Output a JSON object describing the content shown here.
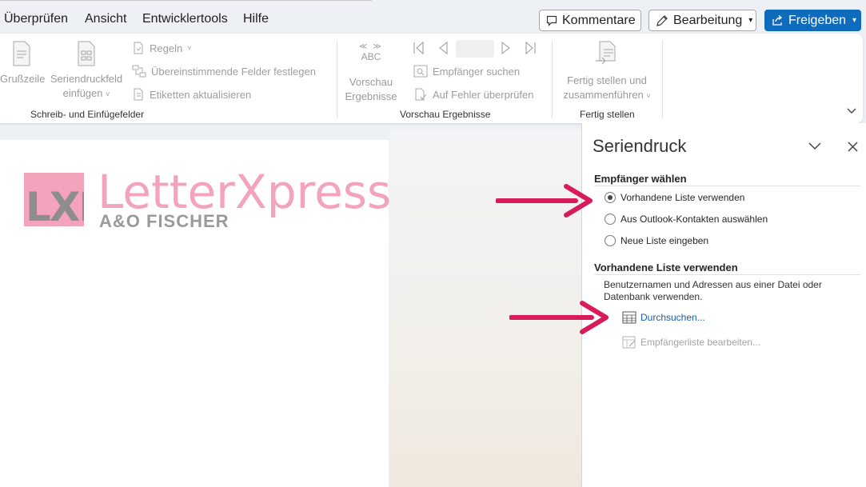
{
  "menu": {
    "items": [
      "Überprüfen",
      "Ansicht",
      "Entwicklertools",
      "Hilfe"
    ],
    "comments_label": "Kommentare",
    "editing_label": "Bearbeitung",
    "share_label": "Freigeben"
  },
  "ribbon": {
    "group1": {
      "greeting_label": "Grußzeile",
      "insert_field_line1": "Seriendruckfeld",
      "insert_field_line2": "einfügen",
      "rules_label": "Regeln",
      "match_fields_label": "Übereinstimmende Felder festlegen",
      "update_labels_label": "Etiketten aktualisieren",
      "group_label": "Schreib- und Einfügefelder"
    },
    "group2": {
      "abc_label": "ABC",
      "preview_line1": "Vorschau",
      "preview_line2": "Ergebnisse",
      "find_recipient_label": "Empfänger suchen",
      "check_errors_label": "Auf Fehler überprüfen",
      "group_label": "Vorschau Ergebnisse"
    },
    "group3": {
      "finish_line1": "Fertig stellen und",
      "finish_line2": "zusammenführen",
      "group_label": "Fertig stellen"
    }
  },
  "document": {
    "logo_mark": "LXP",
    "logo_name": "LetterXpress",
    "logo_sub": "A&O FISCHER"
  },
  "pane": {
    "title": "Seriendruck",
    "section1_title": "Empfänger wählen",
    "options": [
      {
        "label": "Vorhandene Liste verwenden",
        "selected": true
      },
      {
        "label": "Aus Outlook-Kontakten auswählen",
        "selected": false
      },
      {
        "label": "Neue Liste eingeben",
        "selected": false
      }
    ],
    "section2_title": "Vorhandene Liste verwenden",
    "description": "Benutzernamen und Adressen aus einer Datei oder Datenbank verwenden.",
    "browse_label": "Durchsuchen...",
    "edit_list_label": "Empfängerliste bearbeiten..."
  },
  "colors": {
    "accent": "#0f6cbd",
    "arrow": "#d81b5b",
    "logo_pink": "#f4a3bd"
  }
}
